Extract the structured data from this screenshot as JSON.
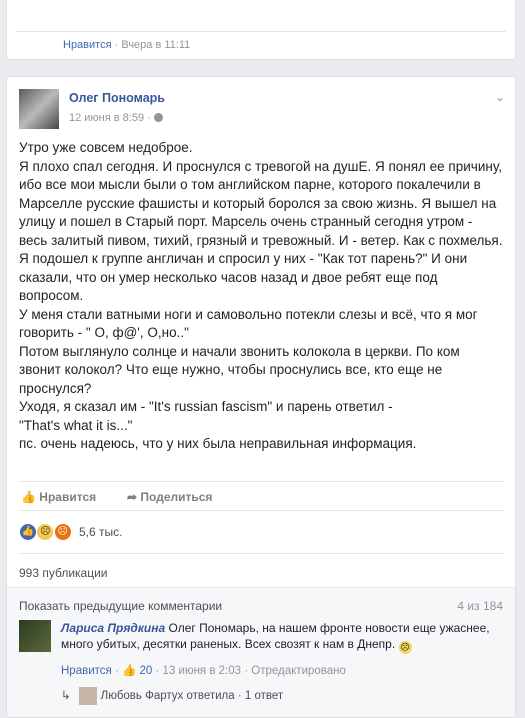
{
  "prev_post": {
    "like": "Нравится",
    "dot": "·",
    "time": "Вчера в 11:11"
  },
  "post": {
    "author": "Олег Пономарь",
    "time": "12 июня в 8:59 ·",
    "chevron_icon": "chevron-down-icon",
    "body": "Утро уже совсем недоброе.\nЯ плохо спал сегодня. И проснулся с тревогой на душЕ. Я понял ее причину, ибо все мои мысли были о том английском парне, которого покалечили в Марселле русские фашисты и который боролся за свою жизнь. Я вышел на улицу и пошел в Старый порт. Марсель очень странный сегодня утром - весь залитый пивом, тихий, грязный и тревожный. И - ветер. Как с похмелья. Я подошел к группе англичан и спросил у них - \"Как тот парень?\" И они сказали, что он умер несколько часов назад и двое ребят еще под вопросом.\nУ меня стали ватными ноги и самовольно потекли слезы и всё, что я мог говорить - \" О, ф@', О,но..\"\nПотом выглянуло солнце и начали звонить колокола в церкви. По ком звонит колокол? Что еще нужно, чтобы проснулись все, кто еще не проснулся?\nУходя, я сказал им - \"It's russian fascism\" и парень ответил -\n\"That's what it is...\"\nпс. очень надеюсь, что у них была неправильная информация.",
    "like_label": "Нравится",
    "share_label": "Поделиться",
    "reaction_count": "5,6 тыс.",
    "shares": "993 публикации",
    "prev_comments": "Показать предыдущие комментарии",
    "comments_count": "4 из 184",
    "comment": {
      "author": "Лариса Прядкина",
      "text": "Олег Пономарь, на нашем фронте новости еще ужаснее, много убитых, десятки раненых. Всех свозят к нам в Днепр.",
      "like": "Нравится",
      "likes": "20",
      "time": "13 июня в 2:03",
      "edited": "Отредактировано"
    },
    "reply": {
      "author": "Любовь Фартух ответила",
      "count": "1 ответ"
    }
  }
}
